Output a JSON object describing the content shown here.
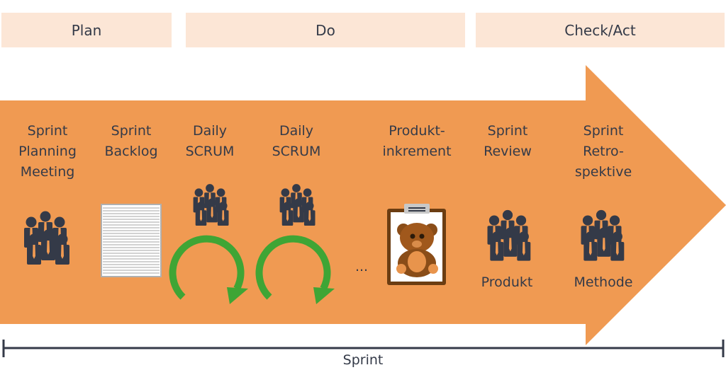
{
  "phases": [
    "Plan",
    "Do",
    "Check/Act"
  ],
  "steps": [
    {
      "label": "Sprint\nPlanning\nMeeting",
      "icon": "people-group-icon"
    },
    {
      "label": "Sprint\nBacklog",
      "icon": "document-icon"
    },
    {
      "label": "Daily\nSCRUM",
      "icon": "people-group-icon"
    },
    {
      "label": "Daily\nSCRUM",
      "icon": "people-group-icon"
    },
    {
      "label": "Produkt-\ninkrement",
      "icon": "teddy-bear-clipboard-icon"
    },
    {
      "label": "Sprint\nReview",
      "icon": "people-group-icon",
      "caption": "Produkt"
    },
    {
      "label": "Sprint\nRetro-\nspektive",
      "icon": "people-group-icon",
      "caption": "Methode"
    }
  ],
  "ellipsis": "...",
  "timeline_label": "Sprint",
  "colors": {
    "arrow": "#f09a52",
    "phase_bg": "#fce6d6",
    "cycle": "#3fa535",
    "people": "#343a48"
  }
}
